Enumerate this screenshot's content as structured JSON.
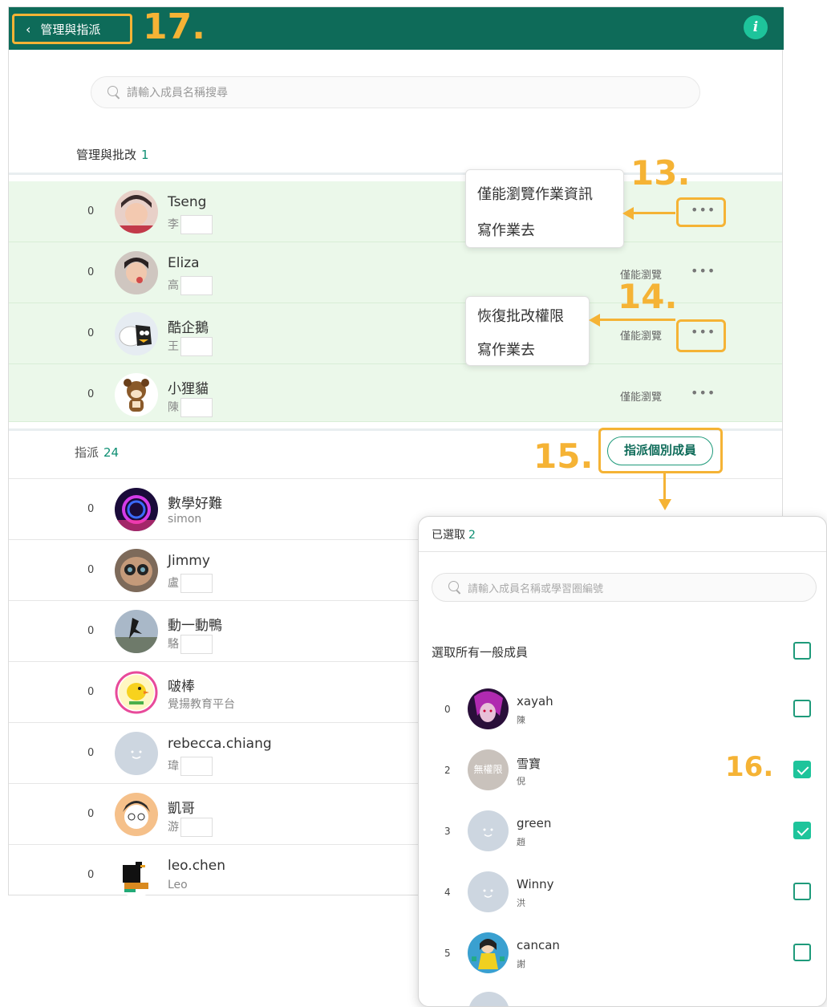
{
  "header": {
    "back_label": "管理與指派",
    "info_symbol": "i"
  },
  "search": {
    "placeholder": "請輸入成員名稱搜尋"
  },
  "manage_section": {
    "title": "管理與批改",
    "count": "1"
  },
  "manage_rows": [
    {
      "num": "0",
      "name": "Tseng",
      "sub": "李",
      "role": "",
      "more": "•••"
    },
    {
      "num": "0",
      "name": "Eliza",
      "sub": "高",
      "role": "僅能瀏覽",
      "more": "•••"
    },
    {
      "num": "0",
      "name": "酷企鵝",
      "sub": "王",
      "role": "僅能瀏覽",
      "more": "•••"
    },
    {
      "num": "0",
      "name": "小狸貓",
      "sub": "陳",
      "role": "僅能瀏覽",
      "more": "•••"
    }
  ],
  "popup_13": {
    "item1": "僅能瀏覽作業資訊",
    "item2": "寫作業去"
  },
  "popup_14": {
    "item1": "恢復批改權限",
    "item2": "寫作業去"
  },
  "assign_section": {
    "title": "指派",
    "count": "24",
    "button": "指派個別成員"
  },
  "assign_rows": [
    {
      "num": "0",
      "name": "數學好難",
      "sub": "simon"
    },
    {
      "num": "0",
      "name": "Jimmy",
      "sub": "盧"
    },
    {
      "num": "0",
      "name": "動一動鴨",
      "sub": "駱"
    },
    {
      "num": "0",
      "name": "啵棒",
      "sub": "覺揚教育平台"
    },
    {
      "num": "0",
      "name": "rebecca.chiang",
      "sub": "瑋"
    },
    {
      "num": "0",
      "name": "凱哥",
      "sub": "游"
    },
    {
      "num": "0",
      "name": "leo.chen",
      "sub": "Leo"
    }
  ],
  "steps": {
    "s13": "13.",
    "s14": "14.",
    "s15": "15.",
    "s16": "16.",
    "s17": "17."
  },
  "selector": {
    "selected_label": "已選取",
    "selected_count": "2",
    "search_placeholder": "請輸入成員名稱或學習圈編號",
    "select_all": "選取所有一般成員",
    "no_perm_badge": "無權限",
    "rows": [
      {
        "num": "0",
        "name": "xayah",
        "sub": "陳",
        "checked": false
      },
      {
        "num": "2",
        "name": "雪寶",
        "sub": "倪",
        "checked": true
      },
      {
        "num": "3",
        "name": "green",
        "sub": "趙",
        "checked": true
      },
      {
        "num": "4",
        "name": "Winny",
        "sub": "洪",
        "checked": false
      },
      {
        "num": "5",
        "name": "cancan",
        "sub": "謝",
        "checked": false
      }
    ]
  },
  "colors": {
    "header_bg": "#0e6b59",
    "accent": "#1ec49b",
    "highlight": "#f5b335",
    "manage_row_bg": "#ebf8ea"
  }
}
